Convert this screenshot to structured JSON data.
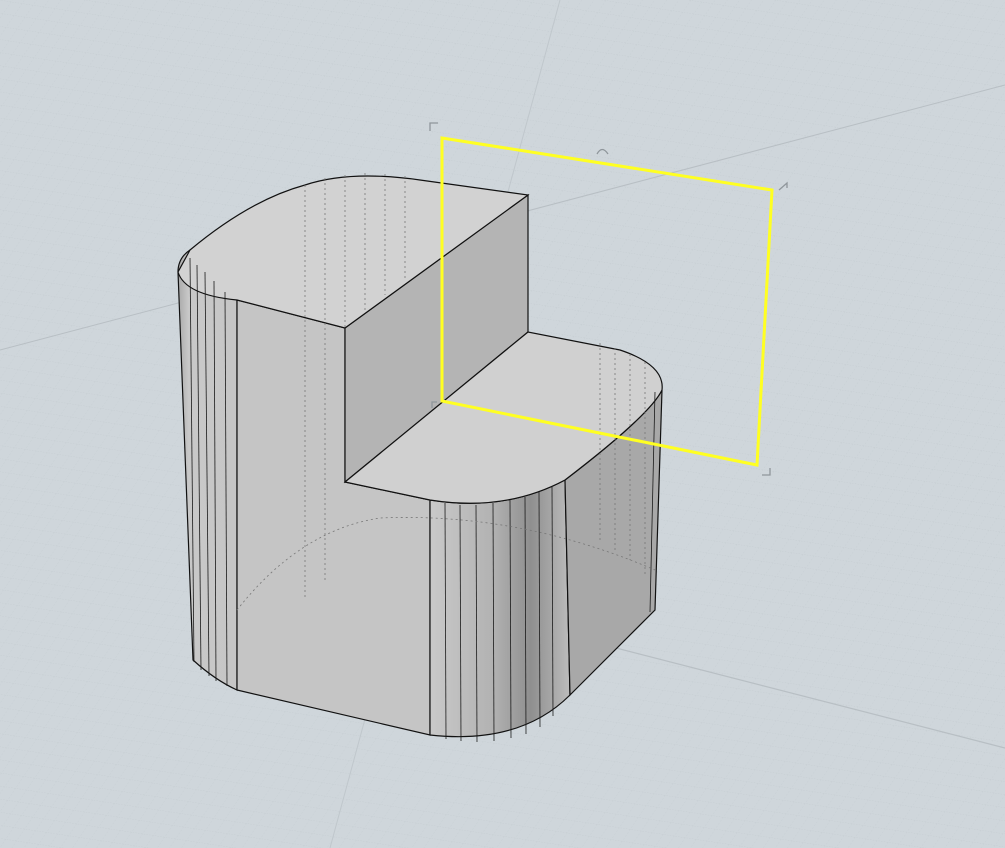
{
  "viewport": {
    "colors": {
      "background": "#cfd6db",
      "grid_minor": "#c4cbd0",
      "grid_major": "#b5bcc1",
      "model_light": "#d3d3d3",
      "model_mid": "#c0c0c0",
      "model_dark": "#a9a9a9",
      "edge": "#111111",
      "selection": "#ffff22",
      "gumball": "#8f969b"
    },
    "selected_object": "clipping-plane",
    "gumball_icons": [
      "corner-handle-icon",
      "rotate-handle-icon",
      "corner-handle-icon",
      "corner-handle-icon",
      "corner-handle-icon"
    ]
  }
}
